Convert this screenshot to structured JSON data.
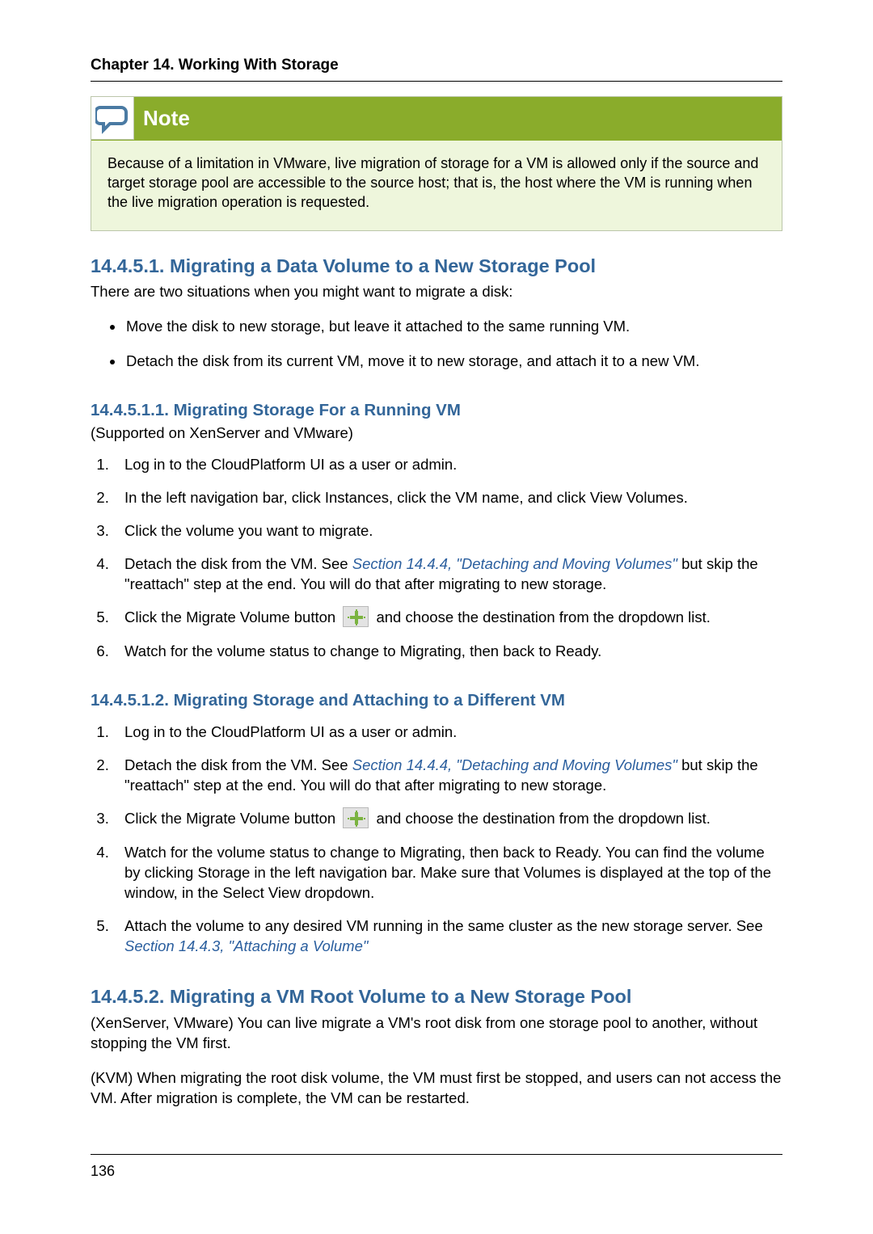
{
  "chapter": "Chapter 14. Working With Storage",
  "note": {
    "label": "Note",
    "body": "Because of a limitation in VMware, live migration of storage for a VM is allowed only if the source and target storage pool are accessible to the source host; that is, the host where the VM is running when the live migration operation is requested."
  },
  "s1451": {
    "title": "14.4.5.1. Migrating a Data Volume to a New Storage Pool",
    "intro": "There are two situations when you might want to migrate a disk:",
    "b1": "Move the disk to new storage, but leave it attached to the same running VM.",
    "b2": "Detach the disk from its current VM, move it to new storage, and attach it to a new VM."
  },
  "s14511": {
    "title": "14.4.5.1.1. Migrating Storage For a Running VM",
    "support": "(Supported on XenServer and VMware)",
    "o1": "Log in to the CloudPlatform UI as a user or admin.",
    "o2": "In the left navigation bar, click Instances, click the VM name, and click View Volumes.",
    "o3": "Click the volume you want to migrate.",
    "o4a": "Detach the disk from the VM. See ",
    "o4link": "Section 14.4.4, \"Detaching and Moving Volumes\"",
    "o4b": " but skip the \"reattach\" step at the end. You will do that after migrating to new storage.",
    "o5a": "Click the Migrate Volume button ",
    "o5b": " and choose the destination from the dropdown list.",
    "o6": "Watch for the volume status to change to Migrating, then back to Ready."
  },
  "s14512": {
    "title": "14.4.5.1.2. Migrating Storage and Attaching to a Different VM",
    "o1": "Log in to the CloudPlatform UI as a user or admin.",
    "o2a": "Detach the disk from the VM. See ",
    "o2link": "Section 14.4.4, \"Detaching and Moving Volumes\"",
    "o2b": " but skip the \"reattach\" step at the end. You will do that after migrating to new storage.",
    "o3a": "Click the Migrate Volume button ",
    "o3b": " and choose the destination from the dropdown list.",
    "o4": "Watch for the volume status to change to Migrating, then back to Ready. You can find the volume by clicking Storage in the left navigation bar. Make sure that Volumes is displayed at the top of the window, in the Select View dropdown.",
    "o5a": "Attach the volume to any desired VM running in the same cluster as the new storage server. See ",
    "o5link": "Section 14.4.3, \"Attaching a Volume\""
  },
  "s1452": {
    "title": "14.4.5.2. Migrating a VM Root Volume to a New Storage Pool",
    "p1": "(XenServer, VMware) You can live migrate a VM's root disk from one storage pool to another, without stopping the VM first.",
    "p2": "(KVM) When migrating the root disk volume, the VM must first be stopped, and users can not access the VM. After migration is complete, the VM can be restarted."
  },
  "page": "136"
}
